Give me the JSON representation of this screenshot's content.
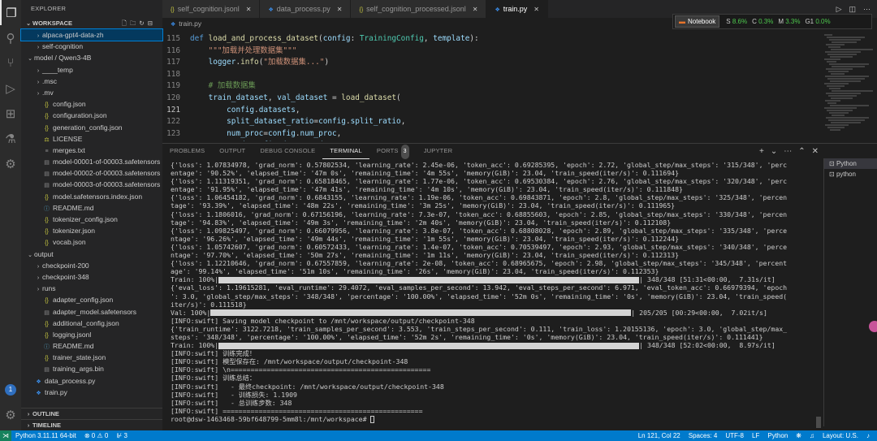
{
  "sidebar": {
    "title": "EXPLORER",
    "workspace": "WORKSPACE",
    "items": [
      {
        "indent": 1,
        "arrow": "›",
        "icon": "",
        "label": "alpaca-gpt4-data-zh",
        "selected": true
      },
      {
        "indent": 1,
        "arrow": "›",
        "icon": "",
        "label": "self-cognition"
      },
      {
        "indent": 0,
        "arrow": "⌄",
        "icon": "",
        "label": "model / Qwen3-4B"
      },
      {
        "indent": 1,
        "arrow": "›",
        "icon": "",
        "label": "____temp"
      },
      {
        "indent": 1,
        "arrow": "›",
        "icon": "",
        "label": ".msc"
      },
      {
        "indent": 1,
        "arrow": "›",
        "icon": "",
        "label": ".mv"
      },
      {
        "indent": 1,
        "arrow": "",
        "icon": "json",
        "label": "config.json"
      },
      {
        "indent": 1,
        "arrow": "",
        "icon": "json",
        "label": "configuration.json"
      },
      {
        "indent": 1,
        "arrow": "",
        "icon": "json",
        "label": "generation_config.json"
      },
      {
        "indent": 1,
        "arrow": "",
        "icon": "lic",
        "label": "LICENSE"
      },
      {
        "indent": 1,
        "arrow": "",
        "icon": "txt",
        "label": "merges.txt"
      },
      {
        "indent": 1,
        "arrow": "",
        "icon": "st",
        "label": "model-00001-of-00003.safetensors"
      },
      {
        "indent": 1,
        "arrow": "",
        "icon": "st",
        "label": "model-00002-of-00003.safetensors"
      },
      {
        "indent": 1,
        "arrow": "",
        "icon": "st",
        "label": "model-00003-of-00003.safetensors"
      },
      {
        "indent": 1,
        "arrow": "",
        "icon": "json",
        "label": "model.safetensors.index.json"
      },
      {
        "indent": 1,
        "arrow": "",
        "icon": "md",
        "label": "README.md"
      },
      {
        "indent": 1,
        "arrow": "",
        "icon": "json",
        "label": "tokenizer_config.json"
      },
      {
        "indent": 1,
        "arrow": "",
        "icon": "json",
        "label": "tokenizer.json"
      },
      {
        "indent": 1,
        "arrow": "",
        "icon": "json",
        "label": "vocab.json"
      },
      {
        "indent": 0,
        "arrow": "⌄",
        "icon": "",
        "label": "output"
      },
      {
        "indent": 1,
        "arrow": "›",
        "icon": "",
        "label": "checkpoint-200"
      },
      {
        "indent": 1,
        "arrow": "›",
        "icon": "",
        "label": "checkpoint-348"
      },
      {
        "indent": 1,
        "arrow": "›",
        "icon": "",
        "label": "runs"
      },
      {
        "indent": 1,
        "arrow": "",
        "icon": "json",
        "label": "adapter_config.json"
      },
      {
        "indent": 1,
        "arrow": "",
        "icon": "st",
        "label": "adapter_model.safetensors"
      },
      {
        "indent": 1,
        "arrow": "",
        "icon": "json",
        "label": "additional_config.json"
      },
      {
        "indent": 1,
        "arrow": "",
        "icon": "json",
        "label": "logging.jsonl"
      },
      {
        "indent": 1,
        "arrow": "",
        "icon": "md",
        "label": "README.md"
      },
      {
        "indent": 1,
        "arrow": "",
        "icon": "json",
        "label": "trainer_state.json"
      },
      {
        "indent": 1,
        "arrow": "",
        "icon": "bin",
        "label": "training_args.bin"
      },
      {
        "indent": 0,
        "arrow": "",
        "icon": "py",
        "label": "data_process.py"
      },
      {
        "indent": 0,
        "arrow": "",
        "icon": "py",
        "label": "train.py"
      }
    ],
    "outline": "OUTLINE",
    "timeline": "TIMELINE"
  },
  "tabs": [
    {
      "label": "self_cognition.jsonl",
      "icon": "json"
    },
    {
      "label": "data_process.py",
      "icon": "py"
    },
    {
      "label": "self_cognition_processed.jsonl",
      "icon": "json"
    },
    {
      "label": "train.py",
      "icon": "py",
      "active": true
    }
  ],
  "notebook_bar": {
    "button": "Notebook",
    "s_label": "S",
    "s_value": "8.6%",
    "c_label": "C",
    "c_value": "0.3%",
    "m_label": "M",
    "m_value": "3.3%",
    "g_label": "G1",
    "g_value": "0.0%"
  },
  "breadcrumb": "train.py",
  "code": {
    "current_line": 121,
    "lines": [
      {
        "n": 115,
        "tokens": [
          [
            "k",
            "def "
          ],
          [
            "f",
            "load_and_process_dataset"
          ],
          [
            "w",
            "("
          ],
          [
            "p",
            "config"
          ],
          [
            "w",
            ": "
          ],
          [
            "t",
            "TrainingConfig"
          ],
          [
            "w",
            ", "
          ],
          [
            "p",
            "template"
          ],
          [
            "w",
            "):"
          ]
        ]
      },
      {
        "n": 116,
        "tokens": [
          [
            "w",
            "    "
          ],
          [
            "s",
            "\"\"\"加载并处理数据集\"\"\""
          ]
        ]
      },
      {
        "n": 117,
        "tokens": [
          [
            "w",
            "    "
          ],
          [
            "p",
            "logger"
          ],
          [
            "w",
            "."
          ],
          [
            "f",
            "info"
          ],
          [
            "w",
            "("
          ],
          [
            "s",
            "\"加载数据集...\""
          ],
          [
            "w",
            ")"
          ]
        ]
      },
      {
        "n": 118,
        "tokens": [
          [
            "w",
            " "
          ]
        ]
      },
      {
        "n": 119,
        "tokens": [
          [
            "w",
            "    "
          ],
          [
            "c",
            "# 加载数据集"
          ]
        ]
      },
      {
        "n": 120,
        "tokens": [
          [
            "w",
            "    "
          ],
          [
            "p",
            "train_dataset"
          ],
          [
            "w",
            ", "
          ],
          [
            "p",
            "val_dataset"
          ],
          [
            "w",
            " = "
          ],
          [
            "f",
            "load_dataset"
          ],
          [
            "w",
            "("
          ]
        ]
      },
      {
        "n": 121,
        "tokens": [
          [
            "w",
            "        "
          ],
          [
            "p",
            "config"
          ],
          [
            "w",
            "."
          ],
          [
            "p",
            "datasets"
          ],
          [
            "w",
            ","
          ]
        ]
      },
      {
        "n": 122,
        "tokens": [
          [
            "w",
            "        "
          ],
          [
            "p",
            "split_dataset_ratio"
          ],
          [
            "w",
            "="
          ],
          [
            "p",
            "config"
          ],
          [
            "w",
            "."
          ],
          [
            "p",
            "split_ratio"
          ],
          [
            "w",
            ","
          ]
        ]
      },
      {
        "n": 123,
        "tokens": [
          [
            "w",
            "        "
          ],
          [
            "p",
            "num_proc"
          ],
          [
            "w",
            "="
          ],
          [
            "p",
            "config"
          ],
          [
            "w",
            "."
          ],
          [
            "p",
            "num_proc"
          ],
          [
            "w",
            ","
          ]
        ]
      },
      {
        "n": 124,
        "tokens": [
          [
            "w",
            "        "
          ],
          [
            "p",
            "seed"
          ],
          [
            "w",
            "="
          ],
          [
            "p",
            "config"
          ],
          [
            "w",
            "."
          ],
          [
            "p",
            "data_seed"
          ]
        ]
      }
    ]
  },
  "panel_tabs": [
    {
      "label": "PROBLEMS"
    },
    {
      "label": "OUTPUT"
    },
    {
      "label": "DEBUG CONSOLE"
    },
    {
      "label": "TERMINAL",
      "active": true
    },
    {
      "label": "PORTS",
      "badge": "3"
    },
    {
      "label": "JUPYTER"
    }
  ],
  "terminal_list": [
    "Python",
    "python"
  ],
  "terminal_lines": [
    "{'loss': 1.07834978, 'grad_norm': 0.57802534, 'learning_rate': 2.45e-06, 'token_acc': 0.69285395, 'epoch': 2.72, 'global_step/max_steps': '315/348', 'perc",
    "entage': '90.52%', 'elapsed_time': '47m 0s', 'remaining_time': '4m 55s', 'memory(GiB)': 23.04, 'train_speed(iter/s)': 0.111694}",
    "{'loss': 1.11319351, 'grad_norm': 0.65818465, 'learning_rate': 1.77e-06, 'token_acc': 0.69530384, 'epoch': 2.76, 'global_step/max_steps': '320/348', 'perc",
    "entage': '91.95%', 'elapsed_time': '47m 41s', 'remaining_time': '4m 10s', 'memory(GiB)': 23.04, 'train_speed(iter/s)': 0.111848}",
    "{'loss': 1.06454182, 'grad_norm': 0.6843155, 'learning_rate': 1.19e-06, 'token_acc': 0.69843871, 'epoch': 2.8, 'global_step/max_steps': '325/348', 'percen",
    "tage': '93.39%', 'elapsed_time': '48m 22s', 'remaining_time': '3m 25s', 'memory(GiB)': 23.04, 'train_speed(iter/s)': 0.111965}",
    "{'loss': 1.1806016, 'grad_norm': 0.67156196, 'learning_rate': 7.3e-07, 'token_acc': 0.68855603, 'epoch': 2.85, 'global_step/max_steps': '330/348', 'percen",
    "tage': '94.83%', 'elapsed_time': '49m 3s', 'remaining_time': '2m 40s', 'memory(GiB)': 23.04, 'train_speed(iter/s)': 0.112108}",
    "{'loss': 1.09825497, 'grad_norm': 0.66079956, 'learning_rate': 3.8e-07, 'token_acc': 0.68808028, 'epoch': 2.89, 'global_step/max_steps': '335/348', 'perce",
    "ntage': '96.26%', 'elapsed_time': '49m 44s', 'remaining_time': '1m 55s', 'memory(GiB)': 23.04, 'train_speed(iter/s)': 0.112244}",
    "{'loss': 1.05742607, 'grad_norm': 0.60572433, 'learning_rate': 1.4e-07, 'token_acc': 0.70539497, 'epoch': 2.93, 'global_step/max_steps': '340/348', 'perce",
    "ntage': '97.70%', 'elapsed_time': '50m 27s', 'remaining_time': '1m 11s', 'memory(GiB)': 23.04, 'train_speed(iter/s)': 0.112313}",
    "{'loss': 1.12210646, 'grad_norm': 0.67557859, 'learning_rate': 2e-08, 'token_acc': 0.68965675, 'epoch': 2.98, 'global_step/max_steps': '345/348', 'percent",
    "age': '99.14%', 'elapsed_time': '51m 10s', 'remaining_time': '26s', 'memory(GiB)': 23.04, 'train_speed(iter/s)': 0.112353}",
    {
      "bar": true,
      "prefix": "Train: 100%|",
      "suffix": "| 348/348 [51:31<00:00,  7.31s/it]"
    },
    "{'eval_loss': 1.19615281, 'eval_runtime': 29.4072, 'eval_samples_per_second': 13.942, 'eval_steps_per_second': 6.971, 'eval_token_acc': 0.66979394, 'epoch",
    "': 3.0, 'global_step/max_steps': '348/348', 'percentage': '100.00%', 'elapsed_time': '52m 0s', 'remaining_time': '0s', 'memory(GiB)': 23.04, 'train_speed(",
    "iter/s)': 0.111518}",
    {
      "bar": true,
      "prefix": "Val: 100%|",
      "suffix": "| 205/205 [00:29<00:00,  7.02it/s]"
    },
    "[INFO:swift] Saving model checkpoint to /mnt/workspace/output/checkpoint-348",
    "{'train_runtime': 3122.7218, 'train_samples_per_second': 3.553, 'train_steps_per_second': 0.111, 'train_loss': 1.20155136, 'epoch': 3.0, 'global_step/max_",
    "steps': '348/348', 'percentage': '100.00%', 'elapsed_time': '52m 2s', 'remaining_time': '0s', 'memory(GiB)': 23.04, 'train_speed(iter/s)': 0.111441}",
    {
      "bar": true,
      "prefix": "Train: 100%|",
      "suffix": "| 348/348 [52:02<00:00,  8.97s/it]"
    },
    "[INFO:swift] 训练完成！",
    "[INFO:swift] 模型保存在: /mnt/workspace/output/checkpoint-348",
    "[INFO:swift] \\n==================================================",
    "[INFO:swift] 训练总结：",
    "[INFO:swift]   - 最终checkpoint: /mnt/workspace/output/checkpoint-348",
    "[INFO:swift]   - 训练损失: 1.1909",
    "[INFO:swift]   - 总训练步数: 348",
    "[INFO:swift] ==================================================",
    {
      "prompt": true,
      "text": "root@dsw-1463468-59bf648799-5mm8l:/mnt/workspace# "
    }
  ],
  "statusbar": {
    "python": "Python 3.11.11 64-bit",
    "errors": "⊗ 0 ⚠ 0",
    "ports": "⊮ 3",
    "cursor_pos": "Ln 121, Col 22",
    "spaces": "Spaces: 4",
    "encoding": "UTF-8",
    "eol": "LF",
    "language": "Python",
    "layout": "Layout: U.S."
  }
}
